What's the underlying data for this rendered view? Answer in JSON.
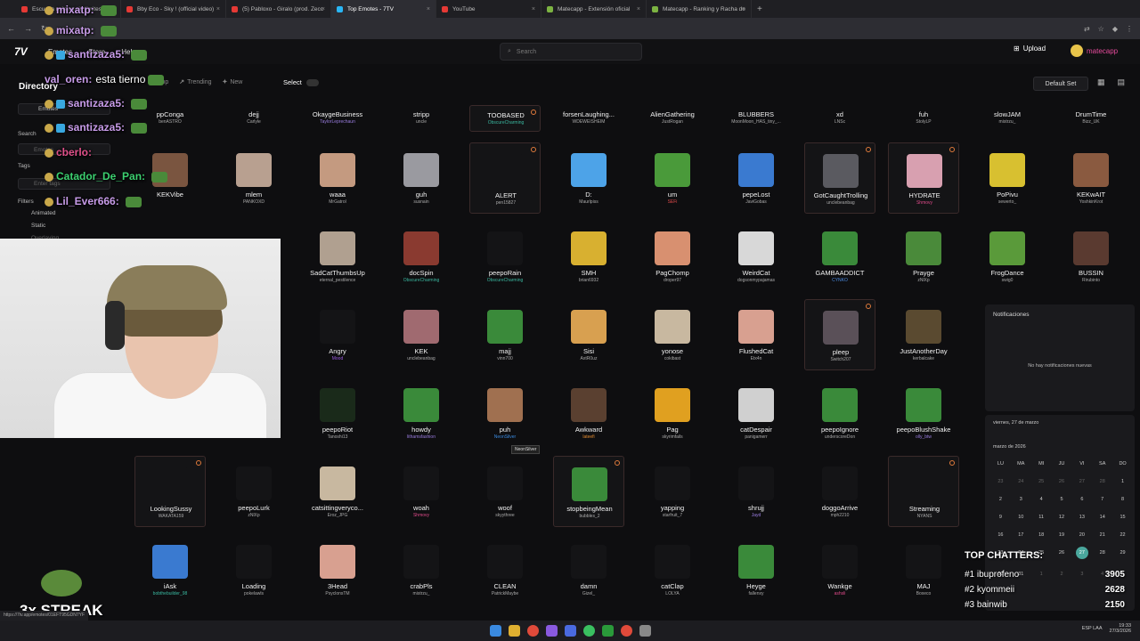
{
  "browser": {
    "tabs": [
      {
        "label": "Escucha música sin límites",
        "color": "#e53935"
      },
      {
        "label": "Bby Eco - Sky ! (official video)",
        "color": "#e53935"
      },
      {
        "label": "(5) Pabloxo - Giralo (prod. Zecc",
        "color": "#e53935"
      },
      {
        "label": "Top Emotes - 7TV",
        "color": "#29b6f6"
      },
      {
        "label": "YouTube",
        "color": "#e53935"
      },
      {
        "label": "Matecapp - Extensión oficial",
        "color": "#7cb342"
      },
      {
        "label": "Matecapp - Ranking y Racha de",
        "color": "#7cb342"
      }
    ],
    "close_glyph": "×",
    "new_tab_glyph": "+",
    "nav_glyphs": [
      "←",
      "→",
      "↻"
    ]
  },
  "site": {
    "logo": "7V",
    "nav": [
      "Emotes",
      "Store",
      "Help"
    ],
    "search_placeholder": "Search",
    "upload_label": "Upload",
    "username": "matecapp"
  },
  "toolbar": {
    "directory": "Directory",
    "sort_tabs": [
      "Top",
      "Trending",
      "New"
    ],
    "select_label": "Select",
    "default_set": "Default Set"
  },
  "sidebar": {
    "emotes": "Emotes",
    "search_label": "Search",
    "search_placeholder": "Emotes",
    "tags_label": "Tags",
    "tags_placeholder": "Enter tags",
    "filters_label": "Filters",
    "filters": [
      "Animated",
      "Static",
      "Overlaying"
    ]
  },
  "emotes": [
    {
      "name": "ppConga",
      "author": "benASTRO",
      "color": "#333",
      "ac": "#aaa"
    },
    {
      "name": "dejj",
      "author": "Carlyle",
      "color": "#333",
      "ac": "#aaa"
    },
    {
      "name": "OkaygeBusiness",
      "author": "TaylorLeprechaun",
      "color": "#333",
      "ac": "#9a7de0"
    },
    {
      "name": "stripp",
      "author": "uncle",
      "color": "#333",
      "ac": "#aaa"
    },
    {
      "name": "TOOBASED",
      "author": "ObscureCharming",
      "color": "#333",
      "ac": "#3ab8a0"
    },
    {
      "name": "forsenLaughing...",
      "author": "WDEWEISHEIM",
      "color": "#333",
      "ac": "#aaa"
    },
    {
      "name": "AlienGathering",
      "author": "JustRogan",
      "color": "#333",
      "ac": "#aaa"
    },
    {
      "name": "BLUBBERS",
      "author": "MoonMoon_HAS_tiny_...",
      "color": "#333",
      "ac": "#aaa"
    },
    {
      "name": "xd",
      "author": "LNSc",
      "color": "#333",
      "ac": "#aaa"
    },
    {
      "name": "fuh",
      "author": "StolyLP",
      "color": "#333",
      "ac": "#aaa"
    },
    {
      "name": "slowJAM",
      "author": "mistrzu_",
      "color": "#333",
      "ac": "#aaa"
    },
    {
      "name": "DrumTime",
      "author": "Bizz_UK",
      "color": "#333",
      "ac": "#aaa"
    },
    {
      "name": "KEKVibe",
      "author": "",
      "color": "#7a5540",
      "ac": "#aaa"
    },
    {
      "name": "mlem",
      "author": "PANKOXD",
      "color": "#b8a090",
      "ac": "#aaa"
    },
    {
      "name": "waaa",
      "author": "MrGatrol",
      "color": "#c49a80",
      "ac": "#aaa"
    },
    {
      "name": "guh",
      "author": "susnain",
      "color": "#9a9aa0",
      "ac": "#aaa"
    },
    {
      "name": "ALERT",
      "author": "pen15827",
      "color": "#141416",
      "ac": "#aaa"
    },
    {
      "name": "D:",
      "author": "Maurlpiss",
      "color": "#4da3e8",
      "ac": "#aaa"
    },
    {
      "name": "um",
      "author": "SEFi",
      "color": "#4a9a3a",
      "ac": "#e04a4a"
    },
    {
      "name": "pepeLost",
      "author": "JaviGobas",
      "color": "#3a7ad0",
      "ac": "#aaa"
    },
    {
      "name": "GotCaughtTrolling",
      "author": "unclebeanbag",
      "color": "#5a5a60",
      "ac": "#aaa"
    },
    {
      "name": "HYDRATE",
      "author": "Shmovy",
      "color": "#d8a0b0",
      "ac": "#e04a8a"
    },
    {
      "name": "PoPivu",
      "author": "sewerto_",
      "color": "#d8c030",
      "ac": "#aaa"
    },
    {
      "name": "KEKwAIT",
      "author": "YoshkinKrot",
      "color": "#8a5a40",
      "ac": "#aaa"
    },
    {
      "name": "SadCatThumbsUp",
      "author": "eternal_pestilence",
      "color": "#b0a090",
      "ac": "#aaa"
    },
    {
      "name": "docSpin",
      "author": "ObscureCharming",
      "color": "#8a3a30",
      "ac": "#3ab8a0"
    },
    {
      "name": "peepoRain",
      "author": "ObscureCharming",
      "color": "#141416",
      "ac": "#3ab8a0"
    },
    {
      "name": "SMH",
      "author": "brian6932",
      "color": "#d8b030",
      "ac": "#aaa"
    },
    {
      "name": "PagChomp",
      "author": "droper97",
      "color": "#d89070",
      "ac": "#aaa"
    },
    {
      "name": "WeirdCat",
      "author": "dogsonmypajamas",
      "color": "#d8d8d8",
      "ac": "#aaa"
    },
    {
      "name": "GAMBAADDICT",
      "author": "CYNKO",
      "color": "#3a8a3a",
      "ac": "#4a8ae0"
    },
    {
      "name": "Prayge",
      "author": "zNlXp",
      "color": "#4a8a3a",
      "ac": "#aaa"
    },
    {
      "name": "FrogDance",
      "author": "swig0",
      "color": "#5a9a3a",
      "ac": "#aaa"
    },
    {
      "name": "BUSSIN",
      "author": "Rirubinto",
      "color": "#5a3a30",
      "ac": "#aaa"
    },
    {
      "name": "",
      "author": "",
      "color": "#141416",
      "ac": "#aaa"
    },
    {
      "name": "",
      "author": "",
      "color": "#141416",
      "ac": "#aaa"
    },
    {
      "name": "Angry",
      "author": "Mood",
      "color": "#141416",
      "ac": "#9a5ae0"
    },
    {
      "name": "KEK",
      "author": "unclebeanbag",
      "color": "#a06a70",
      "ac": "#aaa"
    },
    {
      "name": "majj",
      "author": "vinn700",
      "color": "#3a8a3a",
      "ac": "#aaa"
    },
    {
      "name": "Sisi",
      "author": "AxtR0uz",
      "color": "#d8a050",
      "ac": "#aaa"
    },
    {
      "name": "yonose",
      "author": "cokibast",
      "color": "#c8b8a0",
      "ac": "#aaa"
    },
    {
      "name": "FlushedCat",
      "author": "Etx4n",
      "color": "#d8a090",
      "ac": "#aaa"
    },
    {
      "name": "pleep",
      "author": "Switch207",
      "color": "#5a5058",
      "ac": "#aaa"
    },
    {
      "name": "JustAnotherDay",
      "author": "kerbalcake",
      "color": "#5a4a30",
      "ac": "#aaa"
    },
    {
      "name": "peepoRiot",
      "author": "Tanoshi13",
      "color": "#1a2a1a",
      "ac": "#aaa"
    },
    {
      "name": "howdy",
      "author": "lithamsfashion",
      "color": "#3a8a3a",
      "ac": "#9a7de0"
    },
    {
      "name": "puh",
      "author": "NeonSilver",
      "color": "#a07050",
      "ac": "#3a8ae0"
    },
    {
      "name": "Awkward",
      "author": "lateefi",
      "color": "#5a4030",
      "ac": "#e08a30"
    },
    {
      "name": "Pag",
      "author": "skyrimfails",
      "color": "#e0a020",
      "ac": "#aaa"
    },
    {
      "name": "catDespair",
      "author": "panigamerr",
      "color": "#d0d0d0",
      "ac": "#aaa"
    },
    {
      "name": "peepoIgnore",
      "author": "underscoreDon",
      "color": "#3a8a3a",
      "ac": "#aaa"
    },
    {
      "name": "peepoBlushShake",
      "author": "olly_btw",
      "color": "#3a8a3a",
      "ac": "#9a7de0"
    },
    {
      "name": "LookingSussy",
      "author": "WAKATA159",
      "color": "#141416",
      "ac": "#aaa"
    },
    {
      "name": "peepoLurk",
      "author": "zNlXp",
      "color": "#141416",
      "ac": "#aaa"
    },
    {
      "name": "catsittingveryco...",
      "author": "Eroz_JPG",
      "color": "#c8b8a0",
      "ac": "#aaa"
    },
    {
      "name": "woah",
      "author": "Shmovy",
      "color": "#141416",
      "ac": "#e04a8a"
    },
    {
      "name": "woof",
      "author": "skyythree",
      "color": "#141416",
      "ac": "#aaa"
    },
    {
      "name": "stopbeingMean",
      "author": "bubbles_2",
      "color": "#3a8a3a",
      "ac": "#aaa"
    },
    {
      "name": "yapping",
      "author": "starfruit_7",
      "color": "#141416",
      "ac": "#aaa"
    },
    {
      "name": "shrujj",
      "author": "Jayd",
      "color": "#141416",
      "ac": "#9a7de0"
    },
    {
      "name": "doggoArrive",
      "author": "mph2210",
      "color": "#141416",
      "ac": "#aaa"
    },
    {
      "name": "Streaming",
      "author": "NYANS",
      "color": "#141416",
      "ac": "#aaa"
    },
    {
      "name": "iAsk",
      "author": "bobthebuilder_98",
      "color": "#3a7ad0",
      "ac": "#3ab8a0"
    },
    {
      "name": "Loading",
      "author": "pokelawls",
      "color": "#141416",
      "ac": "#aaa"
    },
    {
      "name": "3Head",
      "author": "PsyclonsTM",
      "color": "#d8a090",
      "ac": "#aaa"
    },
    {
      "name": "crabPls",
      "author": "mistrzu_",
      "color": "#141416",
      "ac": "#aaa"
    },
    {
      "name": "CLEAN",
      "author": "PatrickMaybe",
      "color": "#141416",
      "ac": "#aaa"
    },
    {
      "name": "damn",
      "author": "Gizel_",
      "color": "#141416",
      "ac": "#aaa"
    },
    {
      "name": "catClap",
      "author": "LOLYA",
      "color": "#141416",
      "ac": "#aaa"
    },
    {
      "name": "Heyge",
      "author": "fallenxy",
      "color": "#3a8a3a",
      "ac": "#aaa"
    },
    {
      "name": "Wankge",
      "author": "ashsli",
      "color": "#141416",
      "ac": "#e04a8a"
    },
    {
      "name": "MAJ",
      "author": "Boxeco",
      "color": "#141416",
      "ac": "#aaa"
    }
  ],
  "tooltip": "NeonSilver",
  "chat": [
    {
      "user": "mixatp:",
      "text": "",
      "color": "#c79be8",
      "emote": true
    },
    {
      "user": "mixatp:",
      "text": "",
      "color": "#c79be8",
      "emote": true
    },
    {
      "user": "santizaza5:",
      "text": "",
      "color": "#c79be8",
      "emote": true
    },
    {
      "user": "val_oren:",
      "text": "esta tierno",
      "color": "#c79be8",
      "emote": true
    },
    {
      "user": "santizaza5:",
      "text": "",
      "color": "#c79be8",
      "emote": true
    },
    {
      "user": "santizaza5:",
      "text": "",
      "color": "#c79be8",
      "emote": true
    },
    {
      "user": "cberlo:",
      "text": "",
      "color": "#e0508a",
      "emote": false
    },
    {
      "user": "Catador_De_Pan:",
      "text": "",
      "color": "#3cd070",
      "emote": true
    },
    {
      "user": "Lil_Ever666:",
      "text": "",
      "color": "#c79be8",
      "emote": true
    }
  ],
  "notifications": {
    "title": "Notificaciones",
    "empty": "No hay notificaciones nuevas"
  },
  "calendar": {
    "date_label": "viernes, 27 de marzo",
    "month_label": "marzo de 2026",
    "weekdays": [
      "LU",
      "MA",
      "MI",
      "JU",
      "VI",
      "SA",
      "DO"
    ],
    "days": [
      "23",
      "24",
      "25",
      "26",
      "27",
      "28",
      "1",
      "2",
      "3",
      "4",
      "5",
      "6",
      "7",
      "8",
      "9",
      "10",
      "11",
      "12",
      "13",
      "14",
      "15",
      "16",
      "17",
      "18",
      "19",
      "20",
      "21",
      "22",
      "23",
      "24",
      "25",
      "26",
      "27",
      "28",
      "29",
      "30",
      "31",
      "1",
      "2",
      "3",
      "4",
      "5"
    ],
    "today": "27"
  },
  "top_chatters": {
    "title": "TOP CHATTERS:",
    "rows": [
      {
        "rank": "#1 ibuprofeno",
        "value": "3905"
      },
      {
        "rank": "#2 kyommeii",
        "value": "2628"
      },
      {
        "rank": "#3 bainwib",
        "value": "2150"
      }
    ]
  },
  "streak": "3x STREAK",
  "status_url": "https://7tv.app/emotes/01EFT95GDN7YF",
  "clock": {
    "time": "19:33",
    "date": "27/3/2026",
    "lang": "ESP LAA"
  }
}
